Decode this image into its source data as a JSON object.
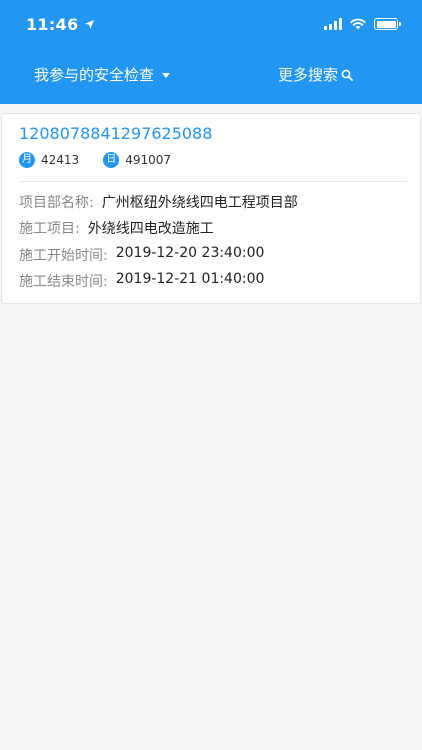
{
  "status_bar": {
    "time": "11:46"
  },
  "nav": {
    "filter_label": "我参与的安全检查",
    "more_search_label": "更多搜索"
  },
  "record": {
    "id": "1208078841297625088",
    "month_badge": "月",
    "month_value": "42413",
    "day_badge": "日",
    "day_value": "491007",
    "fields": [
      {
        "label": "项目部名称:",
        "value": "广州枢纽外绕线四电工程项目部"
      },
      {
        "label": "施工项目:",
        "value": "外绕线四电改造施工"
      },
      {
        "label": "施工开始时间:",
        "value": "2019-12-20 23:40:00"
      },
      {
        "label": "施工结束时间:",
        "value": "2019-12-21 01:40:00"
      }
    ]
  },
  "colors": {
    "primary": "#2196f3",
    "background": "#f6f6f6",
    "card": "#ffffff"
  }
}
